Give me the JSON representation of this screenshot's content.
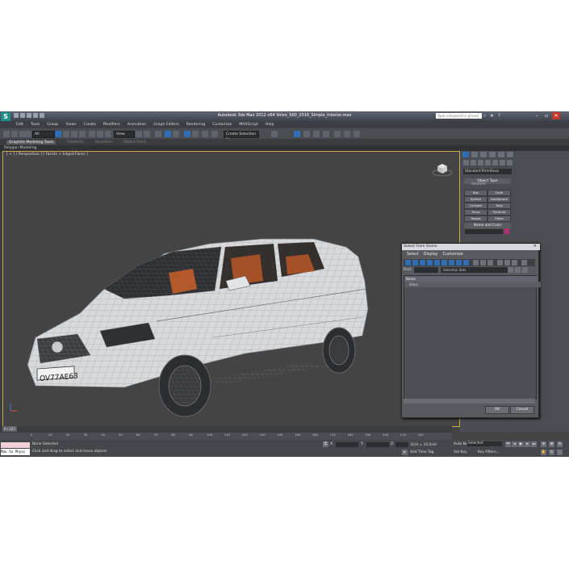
{
  "window": {
    "title": "Autodesk 3ds Max 2012 x64      Volvo_S60_2016_Simple_Interior.max",
    "search_placeholder": "Type a keyword or phrase",
    "logo": "S"
  },
  "menu": [
    "Edit",
    "Tools",
    "Group",
    "Views",
    "Create",
    "Modifiers",
    "Animation",
    "Graph Editors",
    "Rendering",
    "Customize",
    "MAXScript",
    "Help"
  ],
  "toolbar": {
    "selection_filter": "All",
    "reference_coord": "View",
    "named_selection": "Create Selection Se"
  },
  "ribbon": {
    "tabs": [
      "Graphite Modeling Tools",
      "Freeform",
      "Selection",
      "Object Paint"
    ],
    "subpanel": "Polygon Modeling"
  },
  "viewport": {
    "label": "[ + ] [ Perspective ] [ Facets + Edged Faces ]",
    "plate": "OV77AE63"
  },
  "command_panel": {
    "category": "Standard Primitives",
    "object_type_header": "Object Type",
    "autogrid": "AutoGrid",
    "objects": [
      "Box",
      "Cone",
      "Sphere",
      "GeoSphere",
      "Cylinder",
      "Tube",
      "Torus",
      "Pyramid",
      "Teapot",
      "Plane"
    ],
    "name_color_header": "Name and Color",
    "color": "#b42c73"
  },
  "select_from_scene": {
    "title": "Select From Scene",
    "menus": [
      "Select",
      "Display",
      "Customize"
    ],
    "find_label": "Find:",
    "selection_sets": "Selection Sets",
    "column_header": "Name",
    "row": "Volvo",
    "ok": "OK",
    "cancel": "Cancel"
  },
  "timeline": {
    "frame_counter": "0 / 225",
    "ticks": [
      "0",
      "10",
      "20",
      "30",
      "40",
      "50",
      "60",
      "70",
      "80",
      "90",
      "100",
      "110",
      "120",
      "130",
      "140",
      "150",
      "160",
      "170",
      "180",
      "190",
      "200",
      "210",
      "220"
    ]
  },
  "status": {
    "maxscript_label": "Max to Physc",
    "selection": "None Selected",
    "prompt": "Click and drag to select and move objects",
    "grid": "Grid = 10,0cm",
    "add_time_tag": "Add Time Tag",
    "auto_key": "Auto Key",
    "key_mode": "Selected",
    "set_key": "Set Key",
    "key_filters": "Key Filters...",
    "x_label": "X:",
    "y_label": "Y:",
    "z_label": "Z:"
  }
}
